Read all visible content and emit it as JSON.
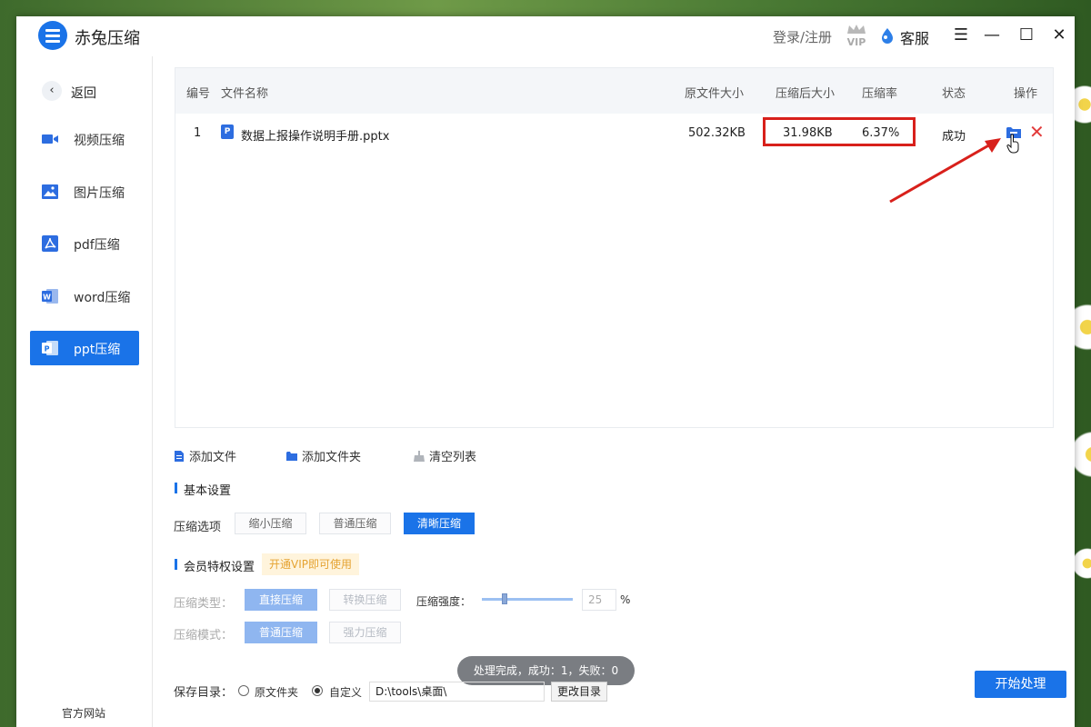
{
  "app": {
    "title": "赤兔压缩"
  },
  "header": {
    "login_label": "登录/注册",
    "vip_text": "VIP",
    "service_label": "客服"
  },
  "sidebar": {
    "back_label": "返回",
    "items": [
      {
        "label": "视频压缩",
        "icon": "video-icon",
        "color": "#2d6de0"
      },
      {
        "label": "图片压缩",
        "icon": "image-icon",
        "color": "#2d6de0"
      },
      {
        "label": "pdf压缩",
        "icon": "pdf-icon",
        "color": "#2d6de0"
      },
      {
        "label": "word压缩",
        "icon": "word-icon",
        "color": "#2d6de0"
      },
      {
        "label": "ppt压缩",
        "icon": "ppt-icon",
        "color": "#2d6de0",
        "active": true
      }
    ],
    "official_site": "官方网站"
  },
  "table": {
    "columns": [
      "编号",
      "文件名称",
      "原文件大小",
      "压缩后大小",
      "压缩率",
      "状态",
      "操作"
    ],
    "rows": [
      {
        "index": "1",
        "filename": "数据上报操作说明手册.pptx",
        "original_size": "502.32KB",
        "compressed_size": "31.98KB",
        "ratio": "6.37%",
        "status": "成功"
      }
    ]
  },
  "actions": {
    "add_file": "添加文件",
    "add_folder": "添加文件夹",
    "clear_list": "清空列表"
  },
  "basic_settings": {
    "title": "基本设置",
    "compress_option_label": "压缩选项",
    "options": [
      "缩小压缩",
      "普通压缩",
      "清晰压缩"
    ],
    "selected": "清晰压缩"
  },
  "vip_settings": {
    "title": "会员特权设置",
    "badge": "开通VIP即可使用",
    "type_label": "压缩类型：",
    "type_options": [
      "直接压缩",
      "转换压缩"
    ],
    "strength_label": "压缩强度：",
    "strength_value": "25",
    "strength_unit": "%",
    "mode_label": "压缩模式：",
    "mode_options": [
      "普通压缩",
      "强力压缩"
    ]
  },
  "toast": "处理完成，成功：1，失败：0",
  "save": {
    "label": "保存目录：",
    "option_original": "原文件夹",
    "option_custom": "自定义",
    "path": "D:\\tools\\桌面\\",
    "change_button": "更改目录"
  },
  "start_button": "开始处理",
  "colors": {
    "accent": "#1a73e8",
    "highlight_box": "#d8201b",
    "delete": "#e23b3b"
  }
}
